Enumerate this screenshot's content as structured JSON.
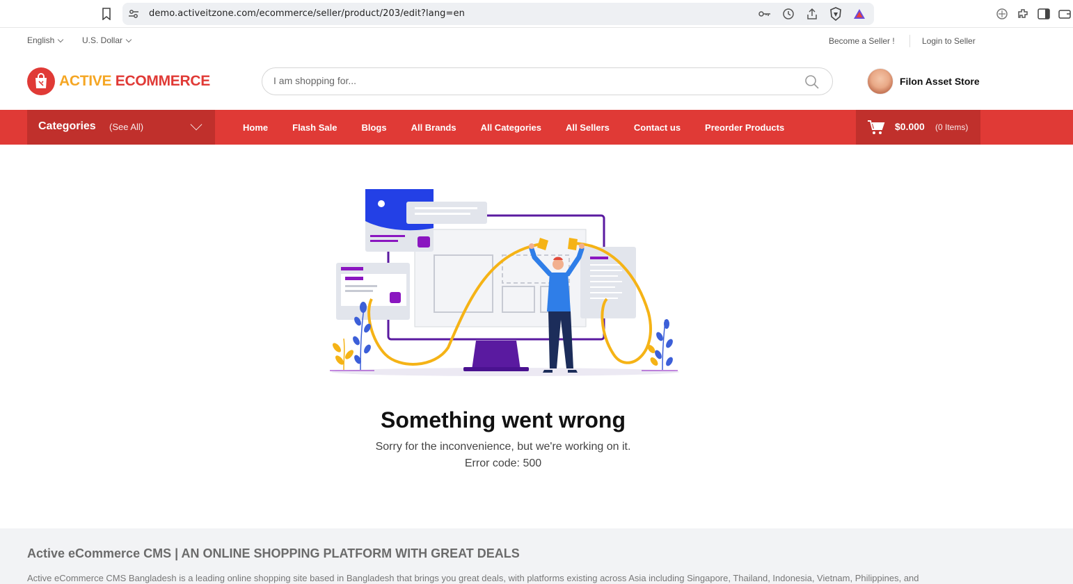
{
  "browser": {
    "url": "demo.activeitzone.com/ecommerce/seller/product/203/edit?lang=en"
  },
  "topbar": {
    "language": "English",
    "currency": "U.S. Dollar",
    "become_seller": "Become a Seller !",
    "login_seller": "Login to Seller"
  },
  "header": {
    "logo_part1": "ACTIVE",
    "logo_part2": "ECOMMERCE",
    "search_placeholder": "I am shopping for...",
    "store_name": "Filon Asset Store"
  },
  "nav": {
    "categories_label": "Categories",
    "see_all": "(See All)",
    "links": [
      "Home",
      "Flash Sale",
      "Blogs",
      "All Brands",
      "All Categories",
      "All Sellers",
      "Contact us",
      "Preorder Products"
    ],
    "cart_total": "$0.000",
    "cart_items": "(0 Items)"
  },
  "error": {
    "title": "Something went wrong",
    "message": "Sorry for the inconvenience, but we're working on it.",
    "code": "Error code: 500"
  },
  "footer": {
    "title": "Active eCommerce CMS | AN ONLINE SHOPPING PLATFORM WITH GREAT DEALS",
    "description": "Active eCommerce CMS Bangladesh is a leading online shopping site based in Bangladesh that brings you great deals, with platforms existing across Asia including Singapore, Thailand, Indonesia, Vietnam, Philippines, and"
  },
  "colors": {
    "brand_red": "#e03a36",
    "brand_dark_red": "#c0302c",
    "brand_orange": "#f5a623"
  }
}
